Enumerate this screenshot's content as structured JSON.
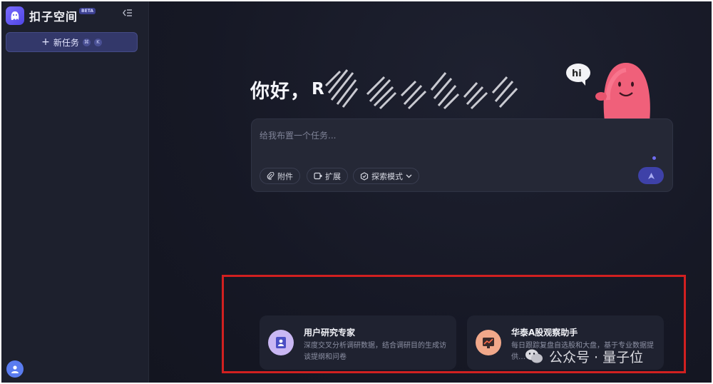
{
  "app": {
    "name": "扣子空间",
    "badge": "BETA"
  },
  "sidebar": {
    "collapse_icon": "collapse-sidebar-icon",
    "new_task_label": "新任务",
    "new_task_shortcut_1": "⌘",
    "new_task_shortcut_2": "K"
  },
  "main": {
    "greeting": "你好，",
    "username_visible": "R",
    "mascot_speech": "hi",
    "input": {
      "placeholder": "给我布置一个任务..."
    },
    "tools": {
      "attach_label": "附件",
      "extend_label": "扩展",
      "explore_label": "探索模式"
    }
  },
  "experts": [
    {
      "title": "用户研究专家",
      "desc": "深度交叉分析调研数据，结合调研目的生成访谈提纲和问卷"
    },
    {
      "title": "华泰A股观察助手",
      "desc": "每日跟踪复盘自选股和大盘，基于专业数据提供…"
    }
  ],
  "watermark": {
    "text": "公众号 · 量子位"
  },
  "colors": {
    "accent": "#3e41a8",
    "background": "#151722",
    "sidebar": "#1d202d",
    "highlight": "#d12020"
  }
}
